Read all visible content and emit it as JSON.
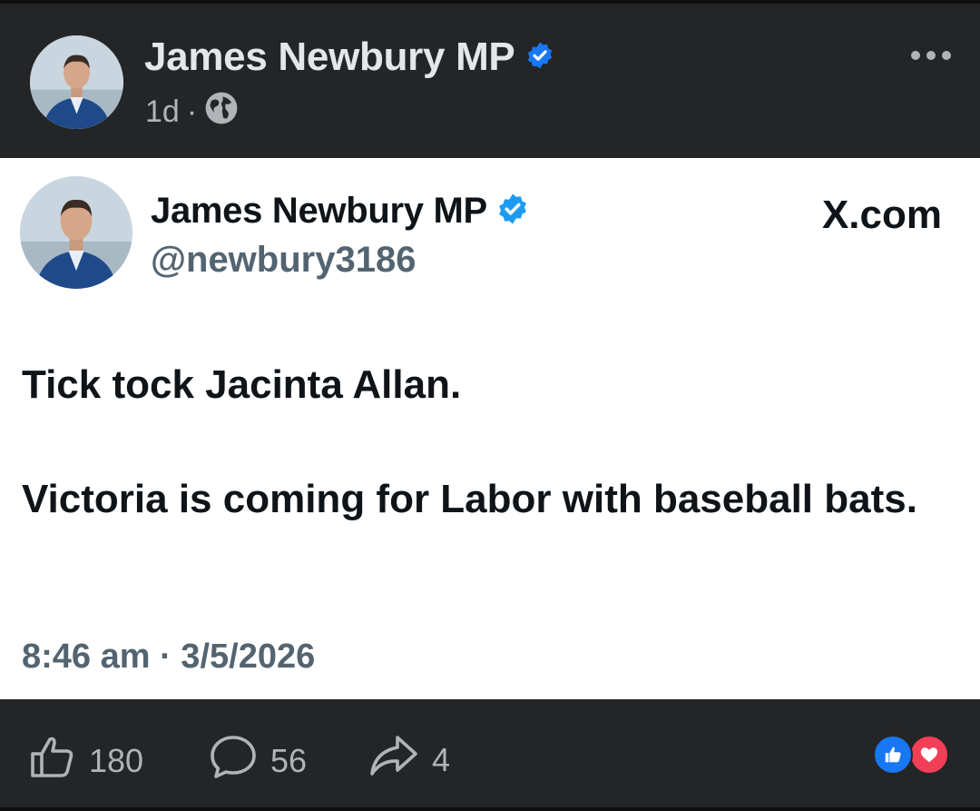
{
  "post": {
    "author": "James Newbury MP",
    "time_ago": "1d",
    "separator": "·"
  },
  "tweet": {
    "name": "James Newbury MP",
    "handle": "@newbury3186",
    "source": "X.com",
    "text_line1": "Tick tock Jacinta Allan.",
    "text_line2": "Victoria is coming for Labor with baseball bats.",
    "timestamp": "8:46 am · 3/5/2026"
  },
  "actions": {
    "likes": "180",
    "comments": "56",
    "shares": "4"
  },
  "icons": {
    "verified": "verified-badge-icon",
    "audience": "globe-icon",
    "more": "more-options-icon",
    "like": "thumbs-up-icon",
    "comment": "comment-bubble-icon",
    "share": "share-arrow-icon",
    "reaction_like": "like-reaction-icon",
    "reaction_love": "love-reaction-icon"
  },
  "colors": {
    "facebook_verified": "#1877f2",
    "twitter_verified": "#1d9bf0",
    "love": "#f33e58",
    "dark_bg": "#242526"
  }
}
